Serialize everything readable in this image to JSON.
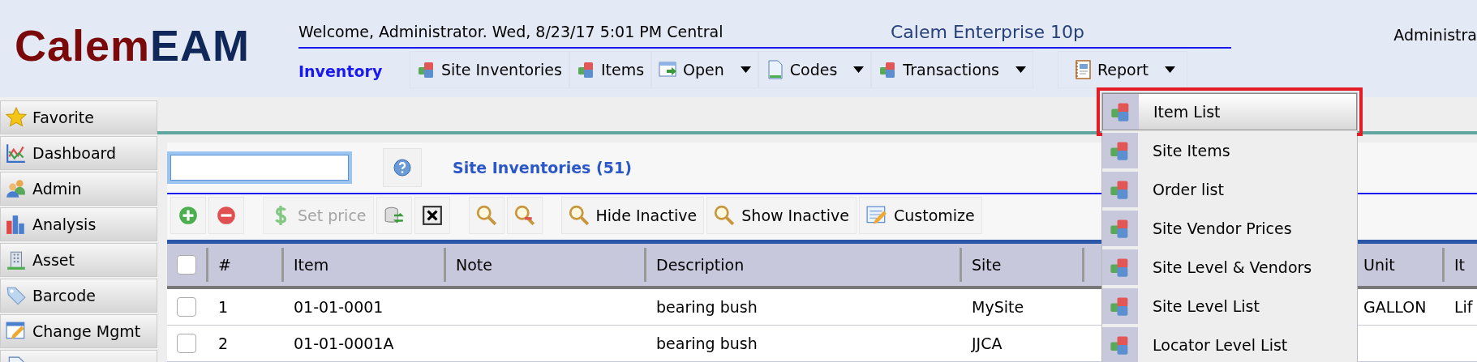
{
  "header": {
    "logo": {
      "first": "Calem",
      "second": "EAM"
    },
    "welcome": "Welcome, Administrator. Wed, 8/23/17 5:01 PM Central",
    "product": "Calem Enterprise 10p",
    "user": "Administra"
  },
  "nav": {
    "module": "Inventory",
    "buttons": [
      {
        "label": "Site Inventories",
        "dropdown": false
      },
      {
        "label": "Items",
        "dropdown": false
      },
      {
        "label": "Open",
        "dropdown": true
      },
      {
        "label": "Codes",
        "dropdown": true
      },
      {
        "label": "Transactions",
        "dropdown": true
      },
      {
        "label": "Report",
        "dropdown": true
      }
    ]
  },
  "sidebar": {
    "items": [
      {
        "label": "Favorite"
      },
      {
        "label": "Dashboard"
      },
      {
        "label": "Admin"
      },
      {
        "label": "Analysis"
      },
      {
        "label": "Asset"
      },
      {
        "label": "Barcode"
      },
      {
        "label": "Change Mgmt"
      }
    ]
  },
  "search": {
    "focused": true
  },
  "title": "Site Inventories (51)",
  "toolbar": [
    {
      "disabled": false
    },
    {
      "disabled": false
    },
    {
      "label": "Set price",
      "disabled": true
    },
    {
      "disabled": false
    },
    {
      "disabled": false
    },
    {
      "disabled": false
    },
    {
      "disabled": false
    },
    {
      "label": "Hide Inactive",
      "disabled": false
    },
    {
      "label": "Show Inactive",
      "disabled": false
    },
    {
      "label": "Customize",
      "disabled": false
    }
  ],
  "table": {
    "all_checked": false,
    "columns": [
      {
        "label": "#"
      },
      {
        "label": "Item"
      },
      {
        "label": "Note"
      },
      {
        "label": "Description"
      },
      {
        "label": "Site"
      },
      {},
      {
        "label": "Unit"
      },
      {
        "label": "It"
      }
    ],
    "rows": [
      {
        "checked": false,
        "cells": [
          "1",
          "01-01-0001",
          null,
          "bearing bush",
          "MySite",
          null,
          "GALLON",
          "Lif"
        ]
      },
      {
        "checked": false,
        "cells": [
          "2",
          "01-01-0001A",
          null,
          "bearing bush",
          "JJCA",
          null,
          null,
          null
        ]
      }
    ]
  },
  "report_menu": {
    "items": [
      {
        "label": "Item List",
        "selected": true
      },
      {
        "label": "Site Items",
        "selected": false
      },
      {
        "label": "Order list",
        "selected": false
      },
      {
        "label": "Site Vendor Prices",
        "selected": false
      },
      {
        "label": "Site Level & Vendors",
        "selected": false
      },
      {
        "label": "Site Level List",
        "selected": false
      },
      {
        "label": "Locator Level List",
        "selected": false
      }
    ]
  }
}
